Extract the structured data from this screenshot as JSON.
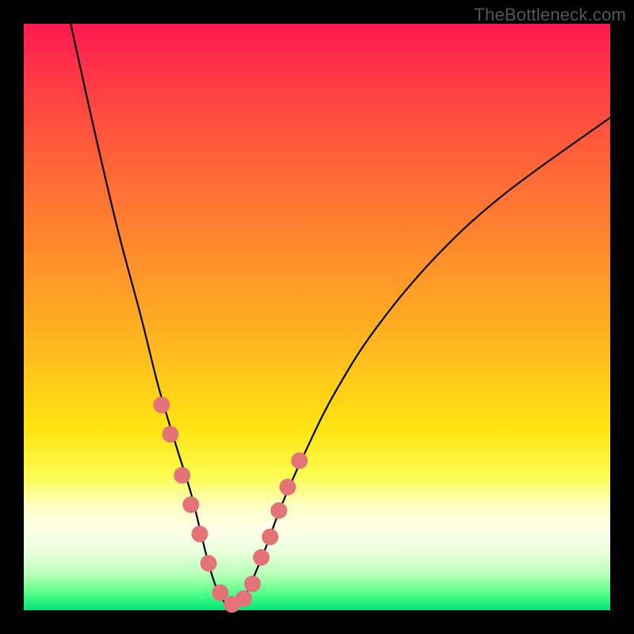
{
  "watermark": "TheBottleneck.com",
  "colors": {
    "frame": "#000000",
    "dot": "#e37379",
    "line": "#000000",
    "gradient_top": "#ff1950",
    "gradient_bottom": "#00e676"
  },
  "chart_data": {
    "type": "line",
    "title": "",
    "xlabel": "",
    "ylabel": "",
    "xlim": [
      0,
      100
    ],
    "ylim": [
      0,
      100
    ],
    "x": [
      8,
      12,
      16,
      20,
      23,
      26,
      28.5,
      30,
      31.5,
      33,
      35,
      36.5,
      38,
      41,
      44,
      48,
      53,
      60,
      70,
      82,
      100
    ],
    "values": [
      100,
      82,
      65,
      50,
      38,
      28,
      20,
      14,
      8,
      3.5,
      0.5,
      0.5,
      3,
      10,
      18,
      27,
      37,
      48,
      60,
      71,
      84
    ],
    "series": [
      {
        "name": "highlighted_points",
        "type": "scatter",
        "x": [
          23.5,
          25,
          27,
          28.5,
          30,
          31.5,
          33.5,
          35.5,
          37.5,
          39,
          40.5,
          42,
          43.5,
          45,
          47
        ],
        "values": [
          35,
          30,
          23,
          18,
          13,
          8,
          3,
          1,
          2,
          4.5,
          9,
          12.5,
          17,
          21,
          25.5
        ]
      }
    ]
  }
}
